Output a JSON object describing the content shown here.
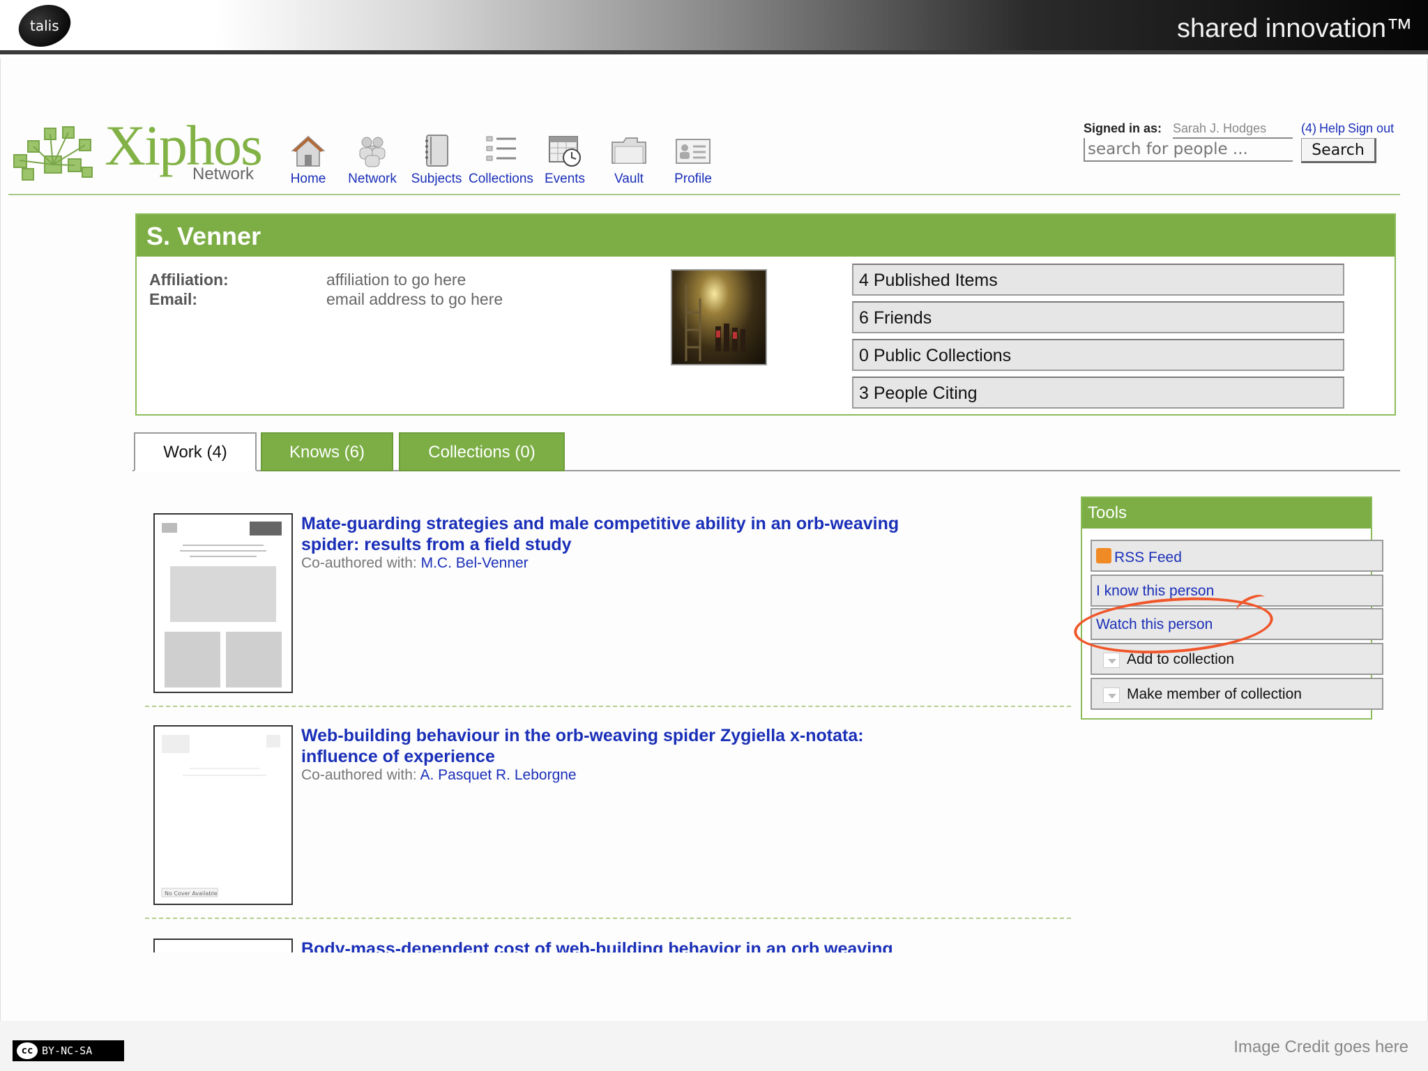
{
  "banner": {
    "logo_text": "talis",
    "tagline": "shared innovation™"
  },
  "app": {
    "name": "Xiphos",
    "subtitle": "Network"
  },
  "nav": [
    {
      "label": "Home",
      "icon": "home-icon"
    },
    {
      "label": "Network",
      "icon": "people-icon"
    },
    {
      "label": "Subjects",
      "icon": "notebook-icon"
    },
    {
      "label": "Collections",
      "icon": "list-icon"
    },
    {
      "label": "Events",
      "icon": "calendar-clock-icon"
    },
    {
      "label": "Vault",
      "icon": "folder-icon"
    },
    {
      "label": "Profile",
      "icon": "profile-card-icon"
    }
  ],
  "account": {
    "signed_label": "Signed in as:",
    "user": "Sarah J. Hodges",
    "count": "(4)",
    "help": "Help",
    "sign_out": "Sign out",
    "search_placeholder": "search for people ...",
    "search_button": "Search"
  },
  "profile": {
    "name": "S. Venner",
    "affiliation_label": "Affiliation:",
    "affiliation_value": "affiliation to go here",
    "email_label": "Email:",
    "email_value": "email address to go here",
    "stats": [
      "4 Published Items",
      "6 Friends",
      "0 Public Collections",
      "3 People Citing"
    ]
  },
  "tabs": [
    "Work (4)",
    "Knows (6)",
    "Collections (0)"
  ],
  "works": [
    {
      "title_line1": "Mate-guarding strategies and male competitive ability in an orb-weaving",
      "title_line2": "spider: results from a field study",
      "coauthor_label": "Co-authored with:",
      "coauthors": "M.C. Bel-Venner"
    },
    {
      "title_line1": "Web-building behaviour in the orb-weaving spider Zygiella x-notata:",
      "title_line2": "influence of experience",
      "coauthor_label": "Co-authored with:",
      "coauthors": "A. Pasquet R. Leborgne",
      "thumb_note": "No Cover Available"
    },
    {
      "title_line1": "Body-mass-dependent cost of web-building behavior in an orb weaving"
    }
  ],
  "tools": {
    "title": "Tools",
    "items": [
      "RSS Feed",
      "I know this person",
      "Watch this person",
      "Add to collection",
      "Make member of collection"
    ]
  },
  "footer": {
    "license": "BY-NC-SA",
    "credit": "Image Credit goes here"
  },
  "colors": {
    "accent_green": "#7cae45",
    "link_blue": "#1a2fb8",
    "highlight": "#f0562a"
  }
}
